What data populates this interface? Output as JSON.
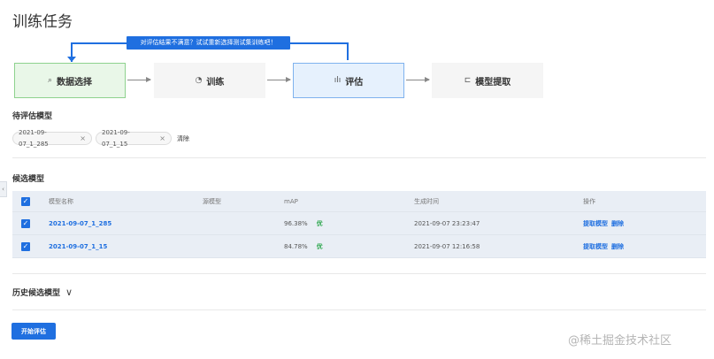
{
  "page": {
    "title": "训练任务"
  },
  "pipeline": {
    "callout": "对评估结果不满意？试试重新选择测试集训练吧！",
    "steps": [
      {
        "label": "数据选择",
        "icon": "⌕"
      },
      {
        "label": "训练",
        "icon": "◔"
      },
      {
        "label": "评估",
        "icon": "ılı"
      },
      {
        "label": "模型提取",
        "icon": "⊏"
      }
    ],
    "colors": {
      "accent": "#1f6fe0",
      "data_step_bg": "#e9f7e8",
      "eval_step_bg": "#e6f1fd"
    }
  },
  "pending": {
    "title": "待评估模型",
    "chips": [
      {
        "label": "2021-09-07_1_285",
        "remove": "×"
      },
      {
        "label": "2021-09-07_1_15",
        "remove": "×"
      }
    ],
    "clear_label": "清除"
  },
  "candidates": {
    "title": "候选模型",
    "columns": {
      "name": "模型名称",
      "source": "源模型",
      "map": "mAP",
      "time": "生成时间",
      "ops": "操作"
    },
    "rows": [
      {
        "name": "2021-09-07_1_285",
        "source": "",
        "map": "96.38%",
        "grade": "优",
        "time": "2021-09-07 23:23:47",
        "extract": "提取模型",
        "delete": "删除"
      },
      {
        "name": "2021-09-07_1_15",
        "source": "",
        "map": "84.78%",
        "grade": "优",
        "time": "2021-09-07 12:16:58",
        "extract": "提取模型",
        "delete": "删除"
      }
    ]
  },
  "history": {
    "label": "历史候选模型",
    "icon": "chevron-down-icon"
  },
  "actions": {
    "start_label": "开始评估"
  },
  "watermark": "@稀土掘金技术社区"
}
